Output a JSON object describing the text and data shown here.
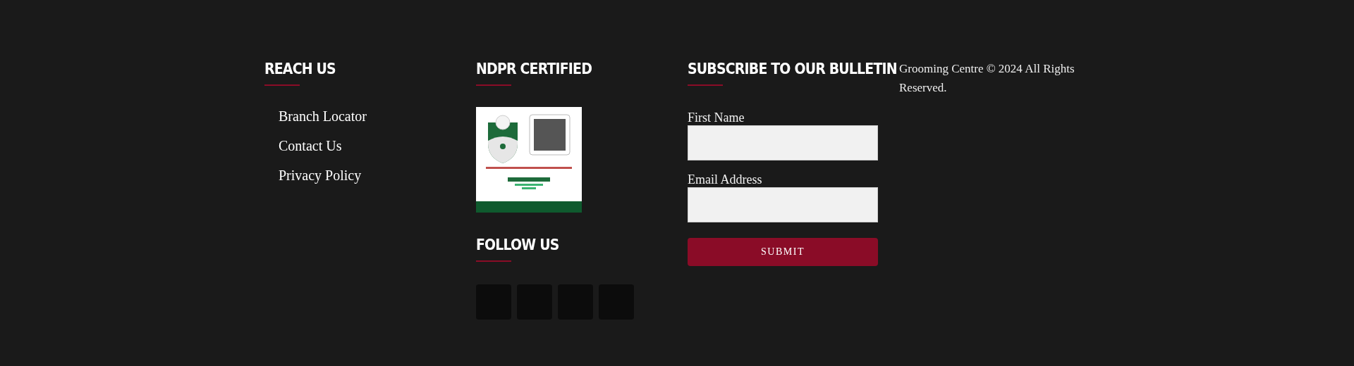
{
  "columns": [
    {
      "kind": "links",
      "title": "REACH US",
      "links": [
        "Branch Locator",
        "Contact Us",
        "Privacy Policy"
      ]
    },
    {
      "kind": "badges",
      "title": "NDPR CERTIFIED",
      "follow": {
        "title": "FOLLOW US",
        "tiles": [
          {
            "kind": "tile"
          },
          {
            "kind": "tile"
          },
          {
            "kind": "tile"
          },
          {
            "kind": "tile"
          }
        ]
      }
    },
    {
      "kind": "form",
      "title": "SUBSCRIBE TO OUR BULLETIN",
      "fields": [
        {
          "label": "First Name"
        },
        {
          "label": "Email Address"
        }
      ],
      "submit": "SUBMIT"
    },
    {
      "kind": "copyright",
      "text": "Grooming Centre © 2024 All Rights Reserved."
    }
  ]
}
